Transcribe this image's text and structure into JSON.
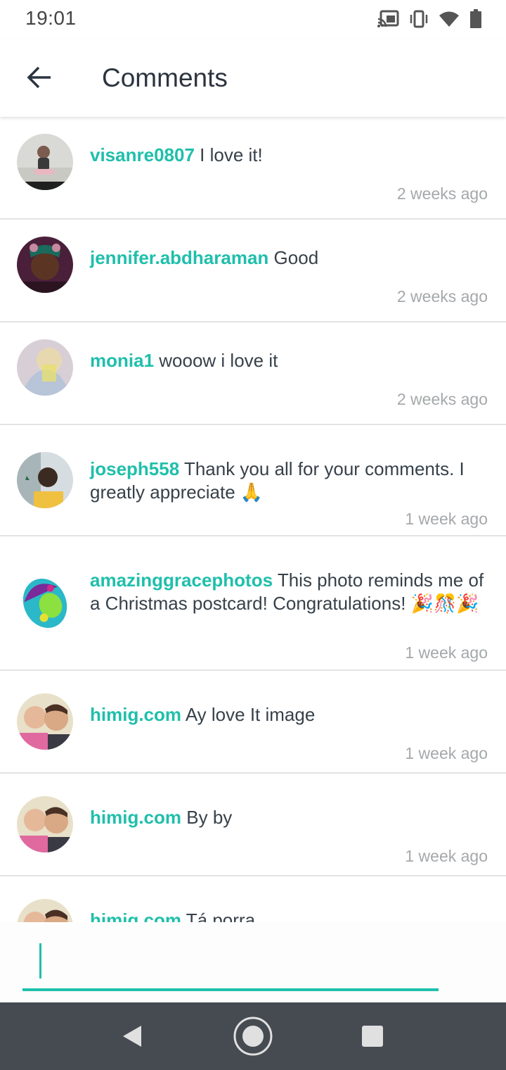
{
  "status_bar": {
    "time": "19:01",
    "icons": [
      "cast-icon",
      "vibrate-icon",
      "wifi-icon",
      "battery-icon"
    ]
  },
  "app_bar": {
    "title": "Comments",
    "back_icon": "arrow-left-icon"
  },
  "comments": [
    {
      "username": "visanre0807",
      "text": "I love it!",
      "time": "2 weeks ago"
    },
    {
      "username": "jennifer.abdharaman",
      "text": "Good",
      "time": "2 weeks ago"
    },
    {
      "username": "monia1",
      "text": "wooow i love it",
      "time": "2 weeks ago"
    },
    {
      "username": "joseph558",
      "text": "Thank you all for your comments. I greatly appreciate 🙏",
      "time": "1 week ago"
    },
    {
      "username": "amazinggracephotos",
      "text": "This photo reminds me of a Christmas postcard! Congratulations! 🎉🎊🎉",
      "time": "1 week ago"
    },
    {
      "username": "himig.com",
      "text": "Ay love It image",
      "time": "1 week ago"
    },
    {
      "username": "himig.com",
      "text": "By by",
      "time": "1 week ago"
    },
    {
      "username": "himig.com",
      "text": "Tá porra",
      "time": ""
    }
  ],
  "comment_input": {
    "value": "",
    "placeholder": ""
  },
  "nav_bar": {
    "icons": [
      "back-triangle-icon",
      "home-circle-icon",
      "recents-square-icon"
    ]
  },
  "colors": {
    "accent": "#1fbfab",
    "text": "#37414a",
    "timestamp": "#a5a8ab",
    "nav_bar": "#464b52"
  }
}
